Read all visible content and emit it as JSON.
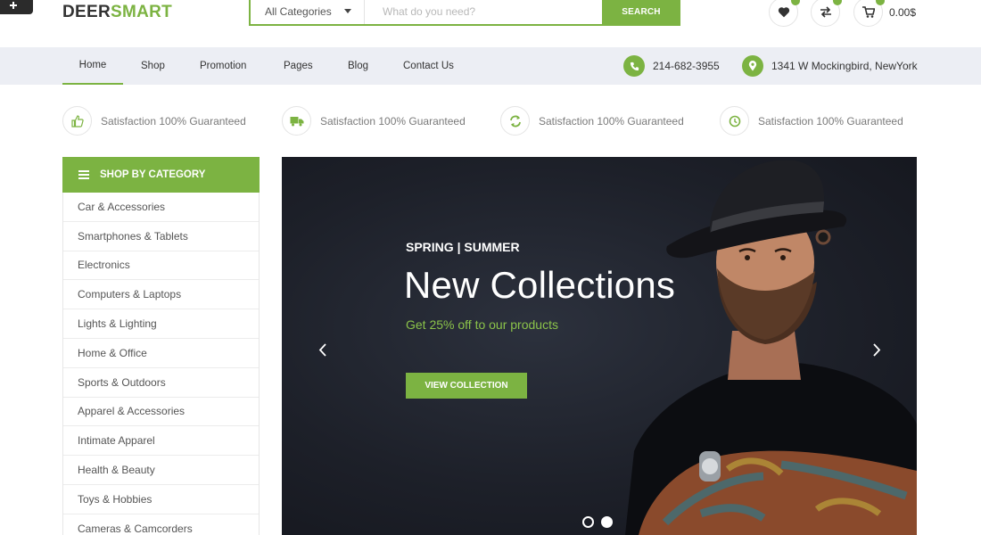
{
  "brand": {
    "logo_part1": "DEER",
    "logo_part2": "SMART"
  },
  "search": {
    "category": "All Categories",
    "placeholder": "What do you need?",
    "button_label": "SEARCH"
  },
  "header": {
    "cart_total": "0.00$"
  },
  "nav": {
    "items": [
      {
        "label": "Home",
        "active": true
      },
      {
        "label": "Shop"
      },
      {
        "label": "Promotion"
      },
      {
        "label": "Pages"
      },
      {
        "label": "Blog"
      },
      {
        "label": "Contact Us"
      }
    ],
    "phone": "214-682-3955",
    "address": "1341 W Mockingbird, NewYork"
  },
  "features": [
    {
      "icon": "thumbs-up-icon",
      "text": "Satisfaction 100% Guaranteed"
    },
    {
      "icon": "truck-icon",
      "text": "Satisfaction 100% Guaranteed"
    },
    {
      "icon": "refresh-icon",
      "text": "Satisfaction 100% Guaranteed"
    },
    {
      "icon": "clock-icon",
      "text": "Satisfaction 100% Guaranteed"
    }
  ],
  "sidebar": {
    "title": "SHOP BY CATEGORY",
    "items": [
      "Car & Accessories",
      "Smartphones & Tablets",
      "Electronics",
      "Computers & Laptops",
      "Lights & Lighting",
      "Home & Office",
      "Sports & Outdoors",
      "Apparel & Accessories",
      "Intimate Apparel",
      "Health & Beauty",
      "Toys & Hobbies",
      "Cameras & Camcorders"
    ]
  },
  "hero": {
    "kicker": "SPRING | SUMMER",
    "title": "New Collections",
    "subtitle": "Get 25% off to our products",
    "cta": "VIEW COLLECTION",
    "active_slide": 2
  },
  "colors": {
    "accent": "#7cb342",
    "nav_bg": "#eceef4",
    "hero_bg": "#1d2029"
  }
}
